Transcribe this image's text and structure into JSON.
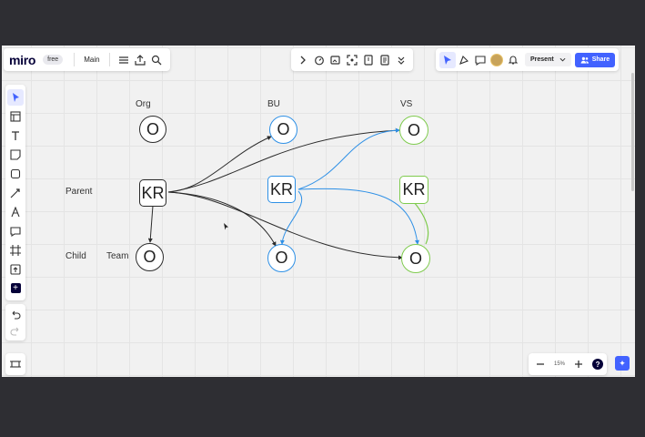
{
  "app": {
    "logo": "miro",
    "plan_badge": "free",
    "board_name": "Main"
  },
  "toolbar": {
    "present_label": "Present",
    "share_label": "Share"
  },
  "zoom": {
    "level": "15%"
  },
  "board": {
    "column_headers": [
      "Org",
      "BU",
      "VS"
    ],
    "row_labels": [
      "Parent",
      "Child"
    ],
    "team_label": "Team",
    "nodes": {
      "org_o": "O",
      "org_kr": "KR",
      "team_o": "O",
      "bu_o": "O",
      "bu_kr": "KR",
      "bu_child_o": "O",
      "vs_o": "O",
      "vs_kr": "KR",
      "vs_child_o": "O"
    }
  },
  "colors": {
    "black_border": "#2b2b2b",
    "blue_border": "#2e90e6",
    "green_border": "#7fcb4e",
    "accent": "#4262ff"
  }
}
